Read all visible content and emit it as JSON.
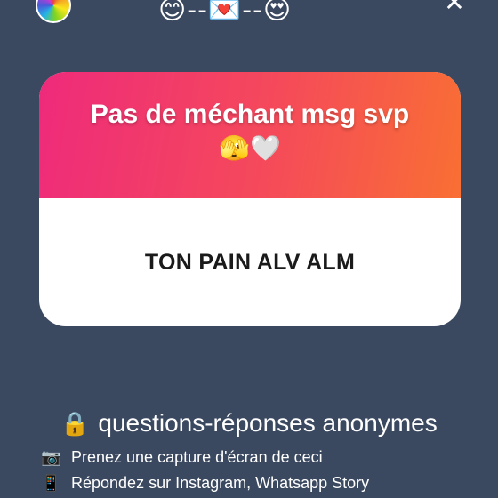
{
  "header": {
    "logo_icon": "color-wheel-icon",
    "title_emojis": "😊--💌--😍",
    "close_label": "✕"
  },
  "card": {
    "prompt": "Pas de méchant msg svp",
    "prompt_emojis": "🫣🤍",
    "answer": "TON PAIN ALV ALM",
    "gradient_colors": [
      "#ee2a7b",
      "#f96f33"
    ]
  },
  "footer": {
    "lock_icon": "🔒",
    "title": "questions-réponses anonymes",
    "lines": [
      {
        "icon": "📷",
        "text": "Prenez une capture d'écran de ceci"
      },
      {
        "icon": "📱",
        "text": "Répondez sur Instagram, Whatsapp Story"
      }
    ]
  },
  "colors": {
    "background": "#3a4860",
    "card_text": "#1a1a1a"
  }
}
